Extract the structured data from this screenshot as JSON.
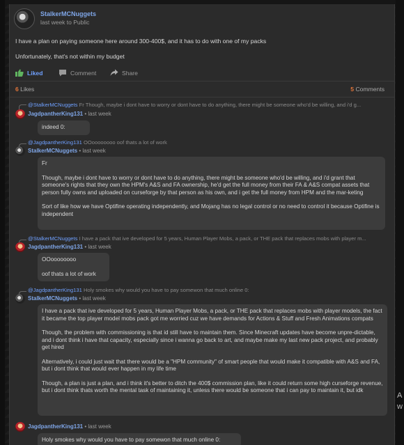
{
  "post": {
    "author": "StalkerMCNuggets",
    "time": "last week to Public",
    "body": [
      "I have a plan on paying someone here around 300-400$, and it has to do with one of my packs",
      "Unfortunately, that's not within my budget"
    ],
    "actions": {
      "like": "Liked",
      "comment": "Comment",
      "share": "Share"
    },
    "likes_count": "6",
    "likes_label": "Likes",
    "comments_count": "5",
    "comments_label": "Comments"
  },
  "comments": [
    {
      "reply_user": "@StalkerMCNuggets",
      "reply_text": "Fr Though, maybe i dont have to worry or dont have to do anything, there might be someone who'd be willing, and i'd g...",
      "author": "JagdpantherKing131",
      "time": "• last week",
      "paragraphs": [
        "indeed 0:"
      ]
    },
    {
      "reply_user": "@JagdpantherKing131",
      "reply_text": "OOoooooooo oof thats a lot of work",
      "author": "StalkerMCNuggets",
      "time": "• last week",
      "paragraphs": [
        "Fr",
        "Though, maybe i dont have to worry or dont have to do anything, there might be someone who'd be willing, and i'd grant that someone's rights that they own the HPM's A&S and FA ownership, he'd get the full money from their FA & A&S compat assets that person fully owns and uploaded on curseforge by that person as his own, and i get the full money from HPM and the mar-keting",
        "Sort of like how we have Optifine operating independently, and Mojang has no legal control or no need to control it because Optifine is independent"
      ]
    },
    {
      "reply_user": "@StalkerMCNuggets",
      "reply_text": "I have a pack that ive developed for 5 years, Human Player Mobs, a pack, or THE pack that replaces mobs with player m...",
      "author": "JagdpantherKing131",
      "time": "• last week",
      "paragraphs": [
        "OOoooooooo",
        "oof thats a lot of work"
      ]
    },
    {
      "reply_user": "@JagdpantherKing131",
      "reply_text": "Holy smokes why would you have to pay somewon that much online 0:",
      "author": "StalkerMCNuggets",
      "time": "• last week",
      "paragraphs": [
        "I have a pack that ive developed for 5 years, Human Player Mobs, a pack, or THE pack that replaces mobs with player models, the fact it became the top player model mobs pack got me worried cuz we have demands for Actions & Stuff and Fresh Animations compats",
        "Though, the problem with commissioning is that id still have to maintain them. Since Minecraft updates have become unpre-dictable, and i dont think i have that capacity, especially since i wanna go back to art, and maybe make my last new pack project, and probably get hired",
        "Alternatively, i could just wait that there would be a \"HPM community\" of smart people that would make it compatible with A&S and FA, but i dont think that would ever happen in my life time",
        "Though, a plan is just a plan, and i think it's better to ditch the 400$ commission plan, like it could return some high curseforge revenue, but i dont think thats worth the mental task of maintaining it, unless there would be someone that i can pay to maintain it, but idk"
      ]
    },
    {
      "reply_user": "",
      "reply_text": "",
      "author": "JagdpantherKing131",
      "time": "• last week",
      "paragraphs": [
        "Holy smokes why would you have to pay somewon that much online 0:"
      ]
    }
  ],
  "side_letters": "A\nw"
}
